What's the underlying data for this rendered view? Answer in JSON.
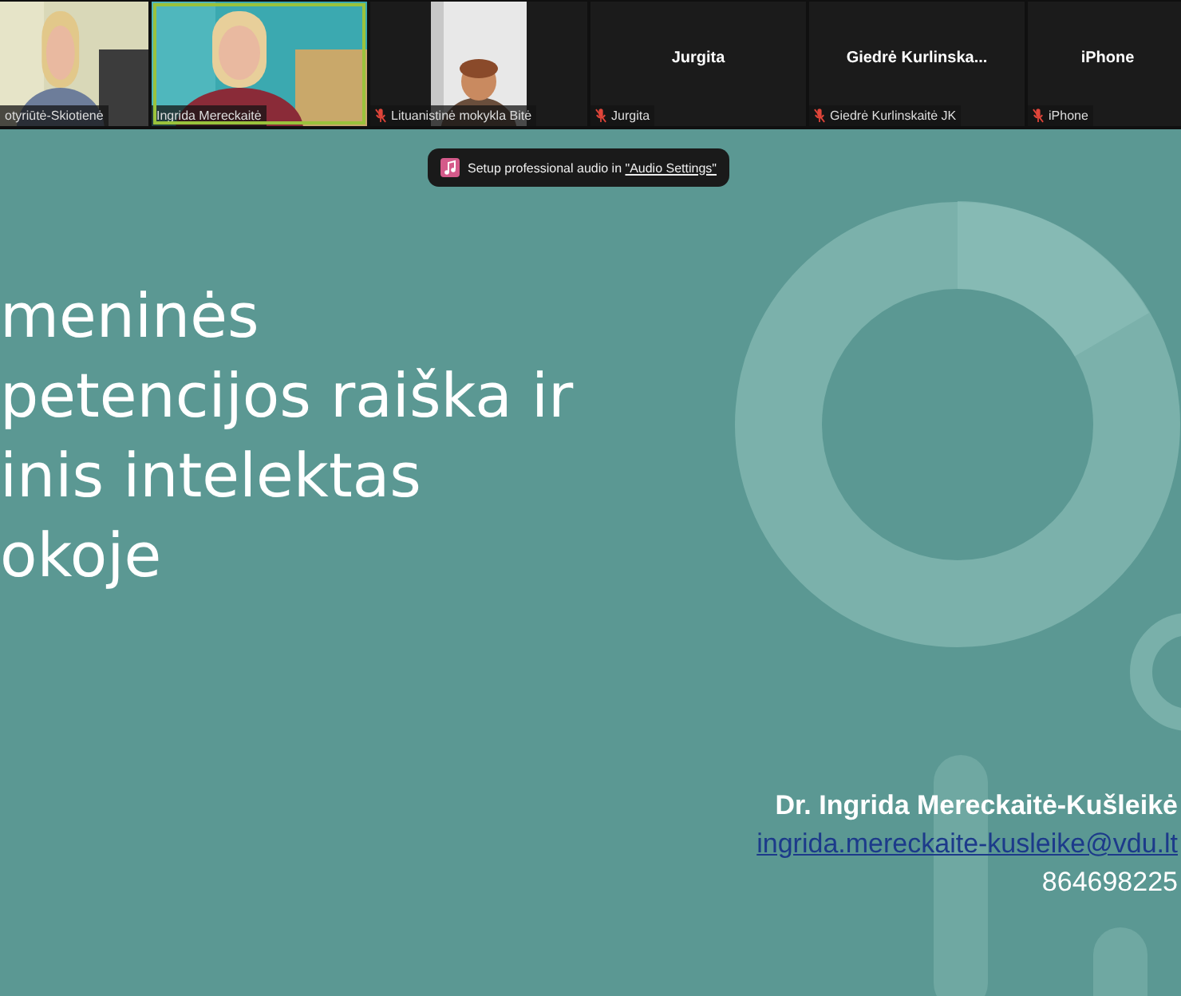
{
  "participants": [
    {
      "kind": "video",
      "name": "otyriūtė-Skiotienė",
      "muted": false,
      "speaking": false
    },
    {
      "kind": "video",
      "name": "Ingrida Mereckaitė",
      "muted": false,
      "speaking": true
    },
    {
      "kind": "video",
      "name": "Lituanistinė mokykla Bitė",
      "muted": true,
      "speaking": false
    },
    {
      "kind": "avatar",
      "display": "Jurgita",
      "name": "Jurgita",
      "muted": true,
      "speaking": false
    },
    {
      "kind": "avatar",
      "display": "Giedrė  Kurlinska...",
      "name": "Giedrė Kurlinskaitė JK",
      "muted": true,
      "speaking": false
    },
    {
      "kind": "avatar",
      "display": "iPhone",
      "name": "iPhone",
      "muted": true,
      "speaking": false
    }
  ],
  "toast": {
    "text": "Setup professional audio in ",
    "link": "\"Audio Settings\""
  },
  "slide": {
    "title_lines": [
      "meninės",
      "petencijos raiška ir",
      "inis intelektas",
      "okoje"
    ],
    "author": "Dr. Ingrida Mereckaitė-Kušleikė",
    "email": "ingrida.mereckaite-kusleike@vdu.lt",
    "phone": "864698225"
  }
}
